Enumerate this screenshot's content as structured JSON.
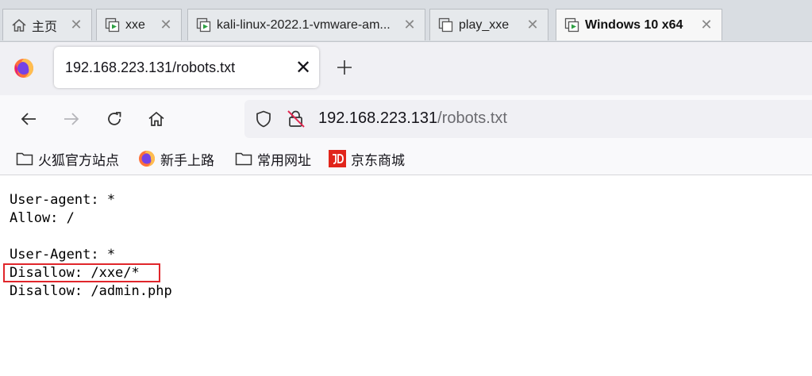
{
  "vm_tabs": [
    {
      "label": "主页",
      "icon": "home-icon",
      "active": false
    },
    {
      "label": "xxe",
      "icon": "vm-icon",
      "active": false
    },
    {
      "label": "kali-linux-2022.1-vmware-am...",
      "icon": "vm-icon",
      "active": false
    },
    {
      "label": "play_xxe",
      "icon": "vm-off-icon",
      "active": false
    },
    {
      "label": "Windows 10 x64",
      "icon": "vm-icon",
      "active": true
    }
  ],
  "browser": {
    "tab_title": "192.168.223.131/robots.txt",
    "url_host": "192.168.223.131",
    "url_path": "/robots.txt"
  },
  "bookmarks": [
    {
      "label": "火狐官方站点",
      "icon": "folder-icon"
    },
    {
      "label": "新手上路",
      "icon": "firefox-icon"
    },
    {
      "label": "常用网址",
      "icon": "folder-icon"
    },
    {
      "label": "京东商城",
      "icon": "jd-icon"
    }
  ],
  "content": {
    "lines": [
      "User-agent: *",
      "Allow: /",
      "",
      "User-Agent: *",
      "Disallow: /xxe/*",
      "Disallow: /admin.php"
    ]
  },
  "colors": {
    "highlight_border": "#e0262b",
    "vm_strip_bg": "#d9dde2",
    "firefox_chrome_bg": "#f0f0f4"
  }
}
